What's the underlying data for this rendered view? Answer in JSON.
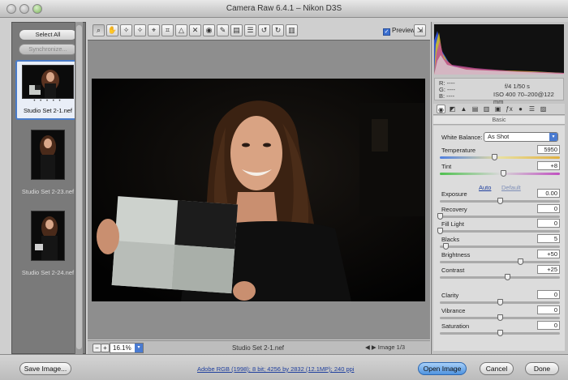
{
  "window": {
    "title": "Camera Raw 6.4.1  –  Nikon D3S"
  },
  "filmstrip": {
    "select_all": "Select All",
    "synchronize": "Synchronize...",
    "items": [
      {
        "label": "Studio Set 2-1.nef"
      },
      {
        "label": "Studio Set 2-23.nef"
      },
      {
        "label": "Studio Set 2-24.nef"
      }
    ]
  },
  "toolbar": {
    "tools": [
      "zoom-icon",
      "hand-icon",
      "eyedropper-icon",
      "color-sampler-icon",
      "target-adjust-icon",
      "crop-icon",
      "straighten-icon",
      "spot-removal-icon",
      "red-eye-icon",
      "adjustment-brush-icon",
      "graduated-filter-icon",
      "preferences-icon",
      "rotate-ccw-icon",
      "rotate-cw-icon",
      "trash-icon"
    ],
    "glyphs": [
      "⌕",
      "✋",
      "✧",
      "✧",
      "⌖",
      "⌗",
      "△",
      "✕",
      "◉",
      "✎",
      "▤",
      "☰",
      "↺",
      "↻",
      "▥"
    ],
    "preview_label": "Preview",
    "preview_checked": true
  },
  "canvas": {
    "zoom": "16.1%",
    "filename": "Studio Set 2-1.nef",
    "image_index": "Image 1/3"
  },
  "info": {
    "r": "R:  ----",
    "g": "G:  ----",
    "b": "B:  ----",
    "aperture_shutter": "f/4   1/50 s",
    "iso_lens": "ISO 400   70–200@122 mm"
  },
  "panel": {
    "section": "Basic",
    "white_balance_label": "White Balance:",
    "white_balance_value": "As Shot",
    "auto": "Auto",
    "default": "Default",
    "controls": [
      {
        "label": "Temperature",
        "value": "5950",
        "level": 0.45
      },
      {
        "label": "Tint",
        "value": "+8",
        "level": 0.53
      },
      {
        "label": "Exposure",
        "value": "0.00",
        "level": 0.5
      },
      {
        "label": "Recovery",
        "value": "0",
        "level": 0.0
      },
      {
        "label": "Fill Light",
        "value": "0",
        "level": 0.0
      },
      {
        "label": "Blacks",
        "value": "5",
        "level": 0.05
      },
      {
        "label": "Brightness",
        "value": "+50",
        "level": 0.67
      },
      {
        "label": "Contrast",
        "value": "+25",
        "level": 0.56
      },
      {
        "label": "Clarity",
        "value": "0",
        "level": 0.5
      },
      {
        "label": "Vibrance",
        "value": "0",
        "level": 0.5
      },
      {
        "label": "Saturation",
        "value": "0",
        "level": 0.5
      }
    ]
  },
  "bottom": {
    "save": "Save Image...",
    "workflow": "Adobe RGB (1998); 8 bit; 4256 by 2832 (12.1MP); 240 ppi",
    "open": "Open Image",
    "cancel": "Cancel",
    "done": "Done"
  },
  "colors": {
    "accent": "#4a7bd1",
    "primary_button": "#4e93e0",
    "canvas": "#8e8e8e"
  }
}
